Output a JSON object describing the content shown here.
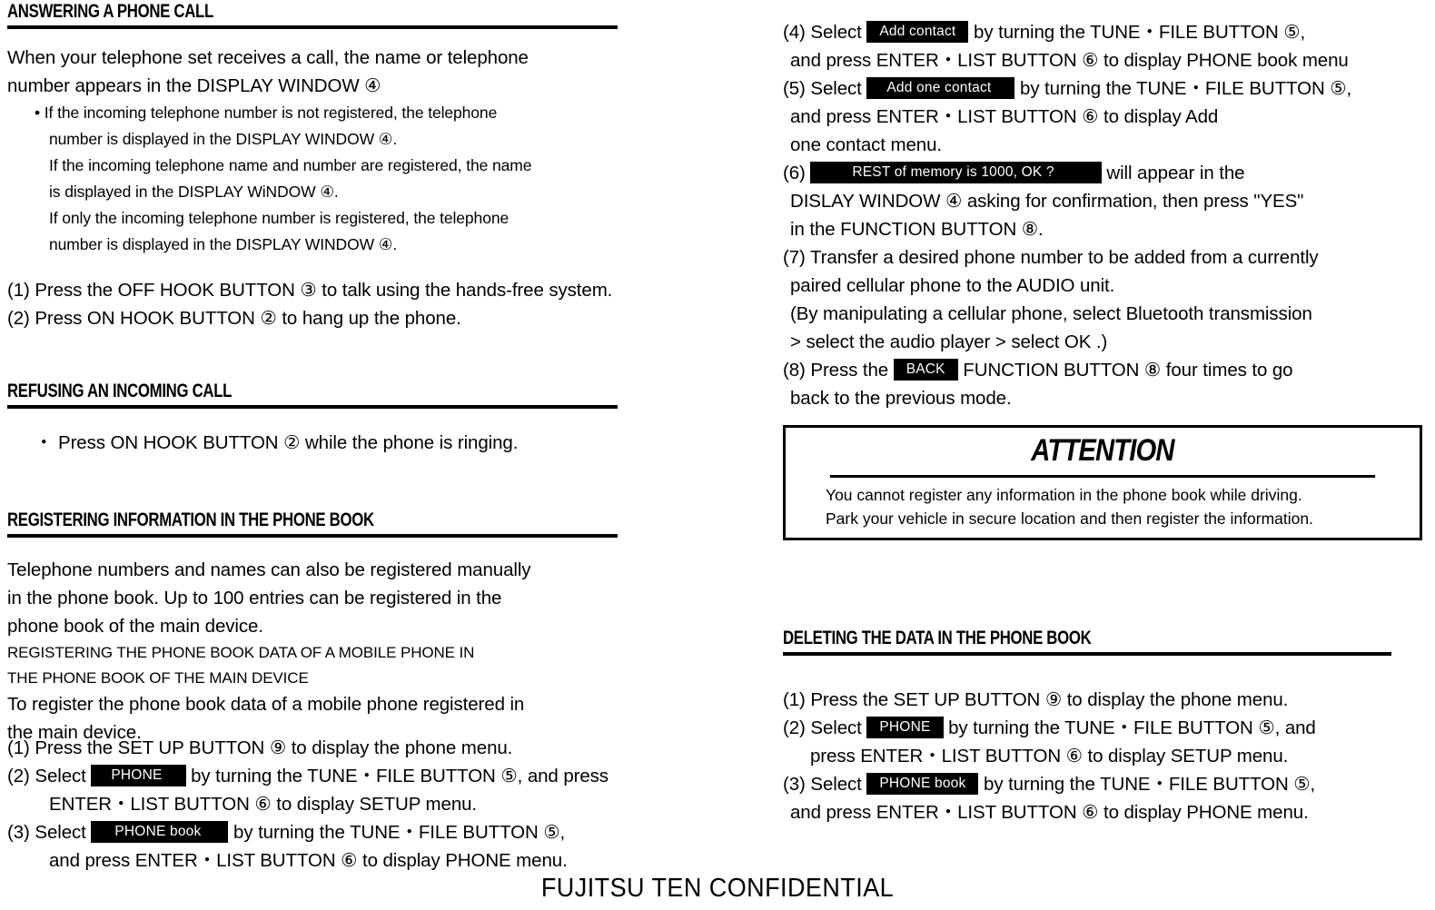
{
  "document": {
    "footer": "FUJITSU TEN CONFIDENTIAL"
  },
  "left_column": {
    "section_answering": {
      "heading": "ANSWERING A PHONE CALL",
      "intro": [
        "When your telephone set receives a call, the name or telephone",
        "number appears in the DISPLAY WINDOW ④"
      ],
      "bullets": [
        "• If the incoming telephone number is not registered, the telephone",
        "number is displayed in the DISPLAY WINDOW  ④.",
        "If the incoming telephone name and number are registered, the name",
        "is displayed in the DISPLAY WiNDOW  ④.",
        "If only the incoming telephone number is registered, the telephone",
        "number is displayed in the DISPLAY WINDOW  ④."
      ],
      "steps": [
        "(1)  Press the OFF HOOK BUTTON ③ to talk using the hands-free system.",
        "(2)  Press ON HOOK BUTTON ② to hang up the phone."
      ]
    },
    "section_refusing": {
      "heading": "REFUSING AN INCOMING CALL",
      "bullet": "・  Press ON HOOK BUTTON ② while the phone is ringing."
    },
    "section_registering": {
      "heading": "REGISTERING INFORMATION IN THE PHONE BOOK",
      "intro": [
        "Telephone numbers and names can also be registered manually",
        "in the phone book. Up to 100 entries can be registered in the",
        "phone book of the main device."
      ],
      "subtitle": [
        "REGISTERING THE PHONE BOOK DATA OF A MOBILE PHONE IN",
        "THE PHONE BOOK OF THE MAIN DEVICE"
      ],
      "intro2": [
        "To register the phone book data of a mobile phone registered in",
        "the main device."
      ],
      "step1": "(1)  Press the SET UP BUTTON ⑨ to display the phone menu.",
      "step2": {
        "marker": "(2)",
        "pre": "Select",
        "badge": "PHONE",
        "post": "by turning the TUNE・FILE BUTTON ⑤, and press",
        "cont": "ENTER・LIST BUTTON ⑥ to display SETUP menu."
      },
      "step3": {
        "marker": "(3)",
        "pre": "Select",
        "badge": "PHONE book",
        "post": "by turning the TUNE・FILE BUTTON ⑤,",
        "cont": "and press ENTER・LIST BUTTON ⑥ to display PHONE menu."
      }
    }
  },
  "right_column": {
    "steps": {
      "step4": {
        "marker": "(4)",
        "pre": "Select",
        "badge": "Add contact",
        "post": "by turning the TUNE・FILE BUTTON ⑤,",
        "cont": "and press ENTER・LIST BUTTON ⑥ to display PHONE book menu"
      },
      "step5": {
        "marker": "(5)",
        "pre": "Select",
        "badge": "Add  one contact",
        "post": "by turning the TUNE・FILE BUTTON ⑤,",
        "cont1": "and press ENTER・LIST BUTTON ⑥ to display Add",
        "cont2": "one contact menu."
      },
      "step6": {
        "marker": "(6)",
        "badge": "REST of memory is 1000, OK ?",
        "post": "will appear in the",
        "cont1": "DISLAY WINDOW ④  asking for confirmation, then press \"YES\"",
        "cont2": "in the FUNCTION BUTTON ⑧."
      },
      "step7": {
        "marker": "(7)",
        "lines": [
          "Transfer a desired phone number to be added from a currently",
          "paired cellular phone to the AUDIO unit.",
          "(By manipulating a cellular phone, select Bluetooth transmission",
          "> select the audio player > select OK .)"
        ]
      },
      "step8": {
        "marker": "(8)",
        "pre": "Press the",
        "badge": "BACK",
        "post": "FUNCTION BUTTON ⑧ four times to go",
        "cont": "back to the previous mode."
      }
    },
    "attention": {
      "title": "ATTENTION",
      "lines": [
        "You cannot register any information in the phone book while driving.",
        "Park your vehicle in secure location and then register the information."
      ]
    },
    "section_deleting": {
      "heading": "DELETING THE DATA IN THE PHONE BOOK",
      "step1": "(1)  Press the SET UP BUTTON ⑨ to display the phone menu.",
      "step2": {
        "marker": "(2)",
        "pre": "Select",
        "badge": "PHONE",
        "post": "by turning the TUNE・FILE BUTTON ⑤, and",
        "cont": "press ENTER・LIST BUTTON ⑥ to display SETUP menu."
      },
      "step3": {
        "marker": "(3)",
        "pre": "Select",
        "badge": "PHONE book",
        "post": "by turning the TUNE・FILE BUTTON ⑤,",
        "cont": "and press ENTER・LIST BUTTON ⑥ to display PHONE menu."
      }
    }
  }
}
